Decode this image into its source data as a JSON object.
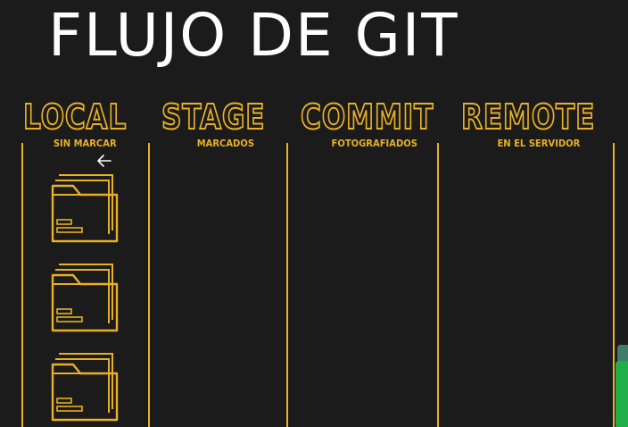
{
  "title": "FLUJO DE GIT",
  "columns": [
    {
      "heading": "LOCAL",
      "subheading": "SIN MARCAR"
    },
    {
      "heading": "STAGE",
      "subheading": "MARCADOS"
    },
    {
      "heading": "COMMIT",
      "subheading": "FOTOGRAFIADOS"
    },
    {
      "heading": "REMOTE",
      "subheading": "EN EL SERVIDOR"
    }
  ],
  "colors": {
    "background": "#1b1b1b",
    "accent": "#e8b125",
    "title": "#ffffff"
  },
  "icons": {
    "file": "folder-with-document-icon",
    "cursor": "back-arrow-cursor-icon"
  }
}
